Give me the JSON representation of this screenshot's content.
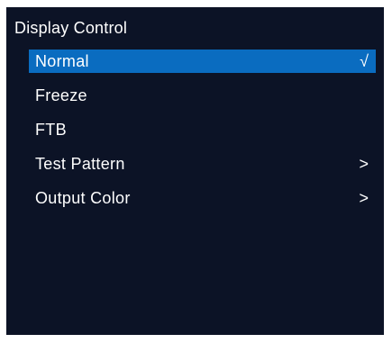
{
  "menu": {
    "title": "Display Control",
    "items": [
      {
        "label": "Normal",
        "indicator": "√",
        "selected": true
      },
      {
        "label": "Freeze",
        "indicator": ""
      },
      {
        "label": "FTB",
        "indicator": ""
      },
      {
        "label": "Test Pattern",
        "indicator": ">"
      },
      {
        "label": "Output Color",
        "indicator": ">"
      }
    ]
  },
  "colors": {
    "background": "#0c1326",
    "highlight": "#0a6cc0",
    "text": "#ffffff"
  }
}
